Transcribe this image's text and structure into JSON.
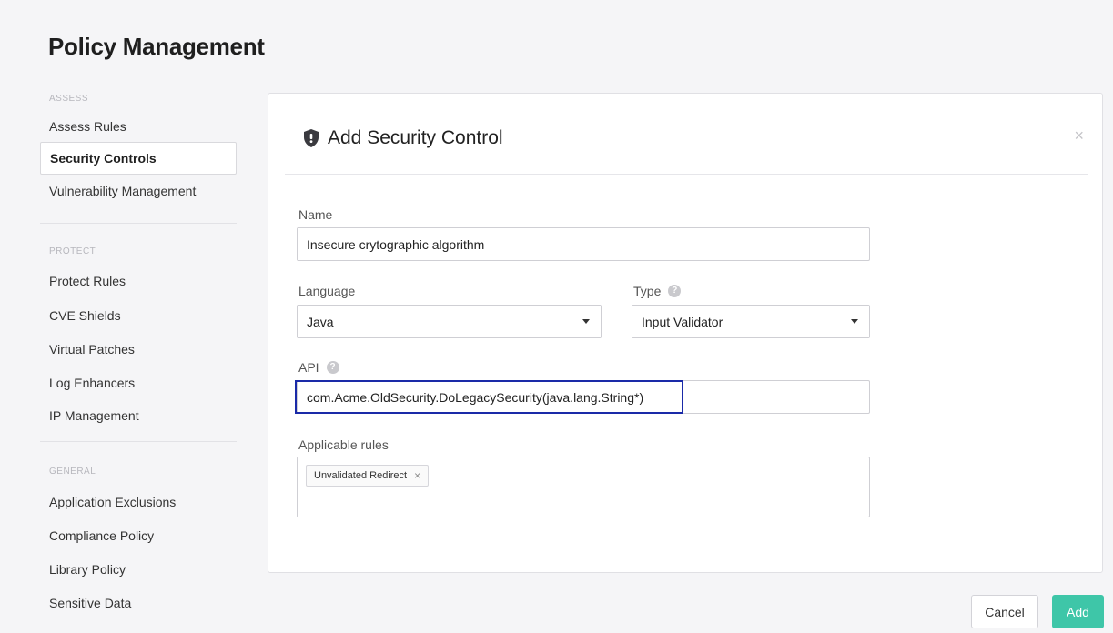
{
  "page": {
    "title": "Policy Management"
  },
  "sidebar": {
    "sections": [
      {
        "label": "ASSESS",
        "items": [
          "Assess Rules",
          "Security Controls",
          "Vulnerability Management"
        ]
      },
      {
        "label": "PROTECT",
        "items": [
          "Protect Rules",
          "CVE Shields",
          "Virtual Patches",
          "Log Enhancers",
          "IP Management"
        ]
      },
      {
        "label": "GENERAL",
        "items": [
          "Application Exclusions",
          "Compliance Policy",
          "Library Policy",
          "Sensitive Data"
        ]
      }
    ],
    "active_item": "Security Controls"
  },
  "modal": {
    "title": "Add Security Control",
    "close_label": "×",
    "name_label": "Name",
    "name_value": "Insecure crytographic algorithm",
    "language_label": "Language",
    "language_value": "Java",
    "type_label": "Type",
    "type_value": "Input Validator",
    "api_label": "API",
    "api_value": "com.Acme.OldSecurity.DoLegacySecurity(java.lang.String*)",
    "rules_label": "Applicable rules",
    "rules_tags": [
      "Unvalidated Redirect"
    ],
    "help_glyph": "?"
  },
  "footer": {
    "cancel_label": "Cancel",
    "add_label": "Add"
  }
}
